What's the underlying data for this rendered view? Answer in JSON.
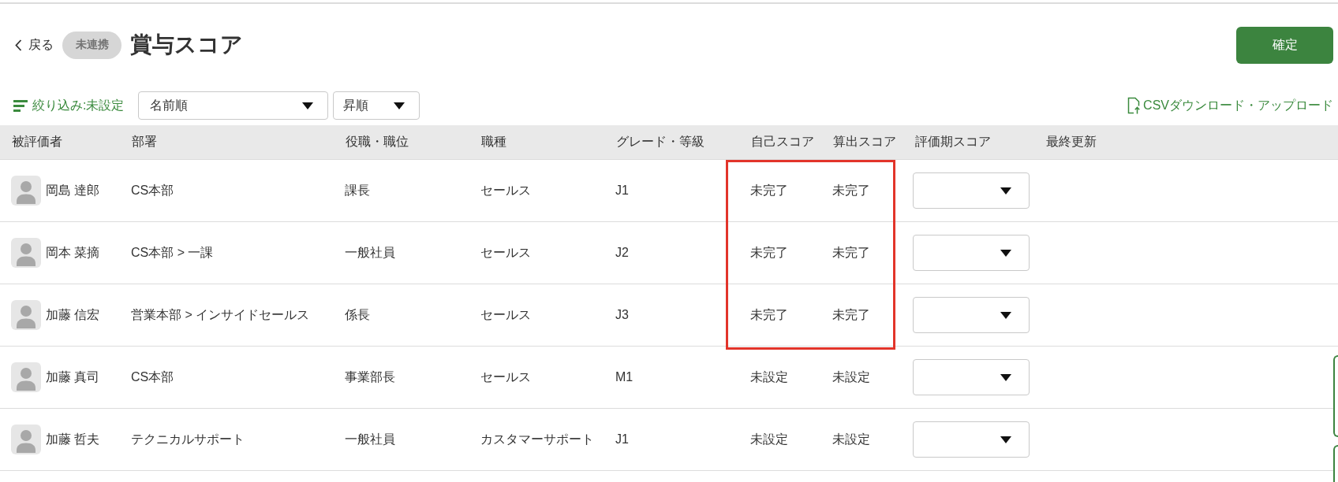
{
  "header": {
    "back_link": "戻る",
    "badge": "未連携",
    "title": "賞与スコア",
    "confirm_button": "確定"
  },
  "toolbar": {
    "filter": "絞り込み:未設定",
    "sort_field": "名前順",
    "sort_order": "昇順",
    "csv_link": "CSVダウンロード・アップロード"
  },
  "table": {
    "columns": [
      "被評価者",
      "部署",
      "役職・職位",
      "職種",
      "グレード・等級",
      "自己スコア",
      "算出スコア",
      "評価期スコア",
      "最終更新"
    ],
    "rows": [
      {
        "name": "岡島 達郎",
        "department": "CS本部",
        "position": "課長",
        "job_type": "セールス",
        "grade": "J1",
        "self_score": "未完了",
        "calculated_score": "未完了",
        "highlighted": true
      },
      {
        "name": "岡本 菜摘",
        "department": "CS本部 > 一課",
        "position": "一般社員",
        "job_type": "セールス",
        "grade": "J2",
        "self_score": "未完了",
        "calculated_score": "未完了",
        "highlighted": true
      },
      {
        "name": "加藤 信宏",
        "department": "営業本部 > インサイドセールス",
        "position": "係長",
        "job_type": "セールス",
        "grade": "J3",
        "self_score": "未完了",
        "calculated_score": "未完了",
        "highlighted": true
      },
      {
        "name": "加藤 真司",
        "department": "CS本部",
        "position": "事業部長",
        "job_type": "セールス",
        "grade": "M1",
        "self_score": "未設定",
        "calculated_score": "未設定",
        "highlighted": false
      },
      {
        "name": "加藤 哲夫",
        "department": "テクニカルサポート",
        "position": "一般社員",
        "job_type": "カスタマーサポート",
        "grade": "J1",
        "self_score": "未設定",
        "calculated_score": "未設定",
        "highlighted": false
      }
    ]
  }
}
